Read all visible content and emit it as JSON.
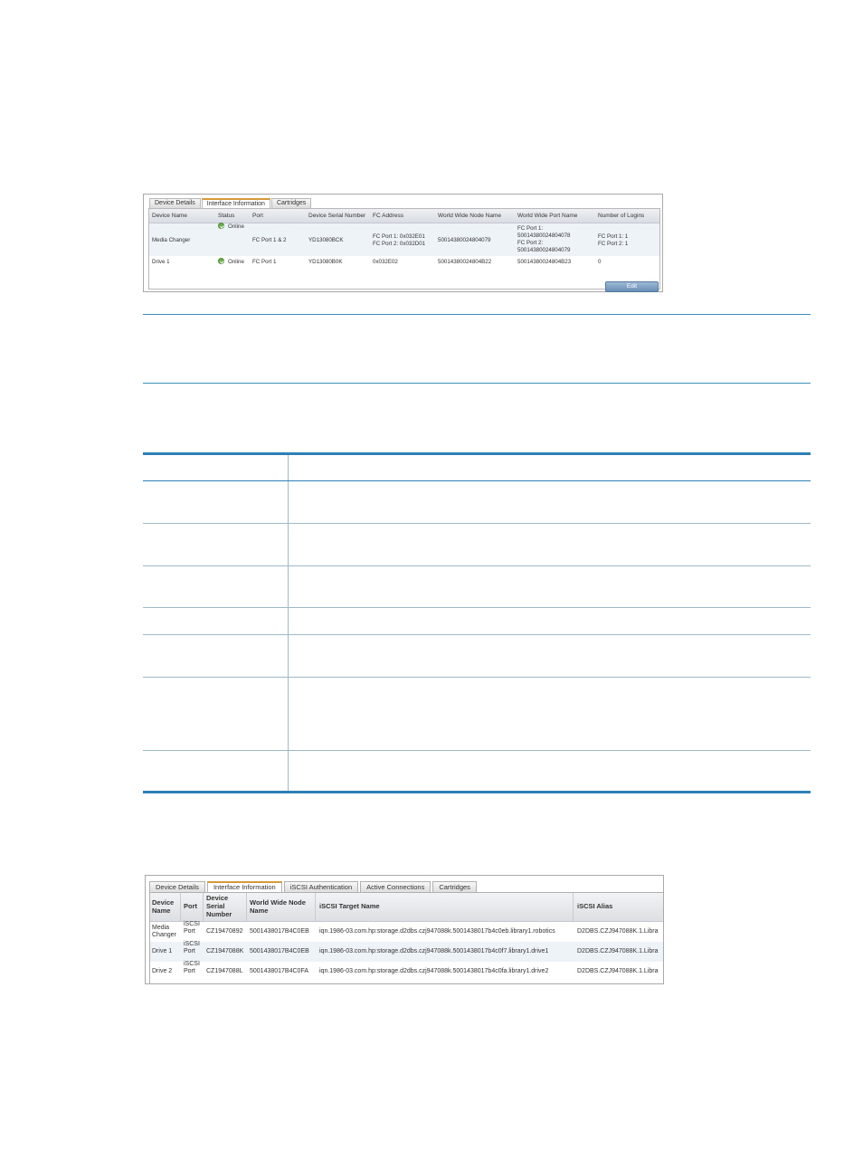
{
  "fc_screenshot": {
    "tabs": [
      "Device Details",
      "Interface Information",
      "Cartridges"
    ],
    "active_tab": 1,
    "headers": [
      "Device Name",
      "Status",
      "Port",
      "Device Serial Number",
      "FC Address",
      "World Wide Node Name",
      "World Wide Port Name",
      "Number of Logins"
    ],
    "rows": [
      {
        "device_name": "Media Changer",
        "status": "Online",
        "port": "FC Port 1 & 2",
        "serial": "YD13080BCK",
        "fc_address": [
          "FC Port 1: 0x032E01",
          "FC Port 2: 0x032D01"
        ],
        "wwnn": "50014380024804079",
        "wwpn": [
          "FC Port 1:",
          "50014380024804078",
          "FC Port 2:",
          "50014380024804079"
        ],
        "logins": [
          "FC Port 1: 1",
          "FC Port 2: 1"
        ]
      },
      {
        "device_name": "Drive 1",
        "status": "Online",
        "port": "FC Port 1",
        "serial": "YD13080B0K",
        "fc_address": "0x032E02",
        "wwnn": "50014380024804B22",
        "wwpn": "50014380024804B23",
        "logins": "0"
      }
    ],
    "edit_label": "Edit",
    "colors": {
      "header": "#dfe3e8",
      "row_alt": "#eef3f8",
      "button": "#7b9cc0",
      "status_ok": "#6ab04c"
    }
  },
  "iscsi_screenshot": {
    "tabs": [
      "Device Details",
      "Interface Information",
      "iSCSI Authentication",
      "Active Connections",
      "Cartridges"
    ],
    "active_tab": 1,
    "headers": {
      "device_name": [
        "Device",
        "Name"
      ],
      "port": "Port",
      "serial": [
        "Device",
        "Serial",
        "Number"
      ],
      "wwnn": [
        "World Wide Node",
        "Name"
      ],
      "target": "iSCSI Target Name",
      "alias": "iSCSI Alias"
    },
    "rows": [
      {
        "device_name": [
          "Media",
          "Changer"
        ],
        "port": [
          "iSCSI",
          "Port"
        ],
        "serial": "CZ19470892",
        "wwnn": "5001438017B4C0EB",
        "target": "iqn.1986-03.com.hp:storage.d2dbs.czj947088k.5001438017b4c0eb.library1.robotics",
        "alias": "D2DBS.CZJ947088K.1.Libra"
      },
      {
        "device_name": [
          "Drive 1"
        ],
        "port": [
          "iSCSI",
          "Port"
        ],
        "serial": "CZ1947088K",
        "wwnn": "5001438017B4C0EB",
        "target": "iqn.1986-03.com.hp:storage.d2dbs.czj947088k.5001438017b4c0f7.library1.drive1",
        "alias": "D2DBS.CZJ947088K.1.Libra"
      },
      {
        "device_name": [
          "Drive 2"
        ],
        "port": [
          "iSCSI",
          "Port"
        ],
        "serial": "CZ1947088L",
        "wwnn": "5001438017B4C0FA",
        "target": "iqn.1986-03.com.hp:storage.d2dbs.czj947088k.5001438017b4c0fa.library1.drive2",
        "alias": "D2DBS.CZJ947088K.1.Libra"
      }
    ]
  },
  "colors": {
    "rule": "#3b8fb8",
    "table_border": "#2e7fb5",
    "table_grid": "#9fb9c8"
  }
}
